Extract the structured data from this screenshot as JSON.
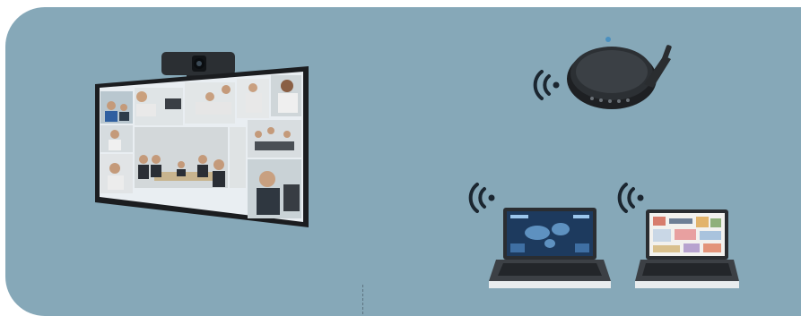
{
  "scene": {
    "background_color": "#86a8b8",
    "panel_color": "#86a8b8",
    "wifi_color": "#1b2630",
    "screen_tiles": [
      "person-tile",
      "person-tile",
      "person-tile",
      "person-tile",
      "person-tile",
      "person-tile",
      "person-tile",
      "person-tile",
      "person-tile",
      "person-tile"
    ],
    "laptop_left_screen": "world-map-dashboard",
    "laptop_right_screen": "document-collage"
  }
}
